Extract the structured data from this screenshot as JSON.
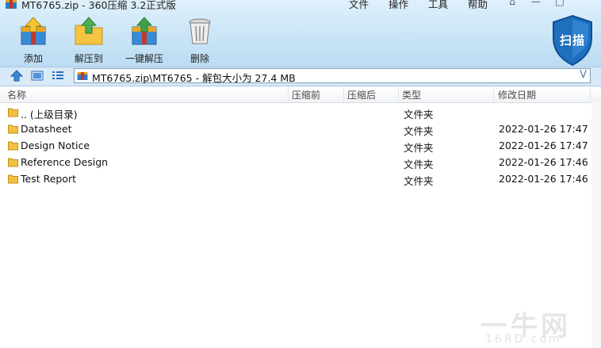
{
  "window": {
    "title": "MT6765.zip - 360压缩 3.2正式版",
    "menus": [
      "文件",
      "操作",
      "工具",
      "帮助"
    ]
  },
  "toolbar": {
    "add_label": "添加",
    "extract_to_label": "解压到",
    "one_click_extract_label": "一键解压",
    "delete_label": "删除",
    "scan_label": "扫描"
  },
  "address": {
    "path": "MT6765.zip\\MT6765 - 解包大小为 27.4 MB",
    "dropdown_glyph": "V"
  },
  "columns": [
    "名称",
    "压缩前",
    "压缩后",
    "类型",
    "修改日期"
  ],
  "rows": [
    {
      "name": ".. (上级目录)",
      "type": "文件夹",
      "modified": ""
    },
    {
      "name": "Datasheet",
      "type": "文件夹",
      "modified": "2022-01-26 17:47"
    },
    {
      "name": "Design Notice",
      "type": "文件夹",
      "modified": "2022-01-26 17:47"
    },
    {
      "name": "Reference Design",
      "type": "文件夹",
      "modified": "2022-01-26 17:46"
    },
    {
      "name": "Test Report",
      "type": "文件夹",
      "modified": "2022-01-26 17:46"
    }
  ],
  "watermark": {
    "main": "一牛网",
    "sub": "16RD.com"
  },
  "colors": {
    "accent": "#2f6fb4",
    "toolbar_bg": "#cfe8f8",
    "shield": "#1f6fbf"
  }
}
